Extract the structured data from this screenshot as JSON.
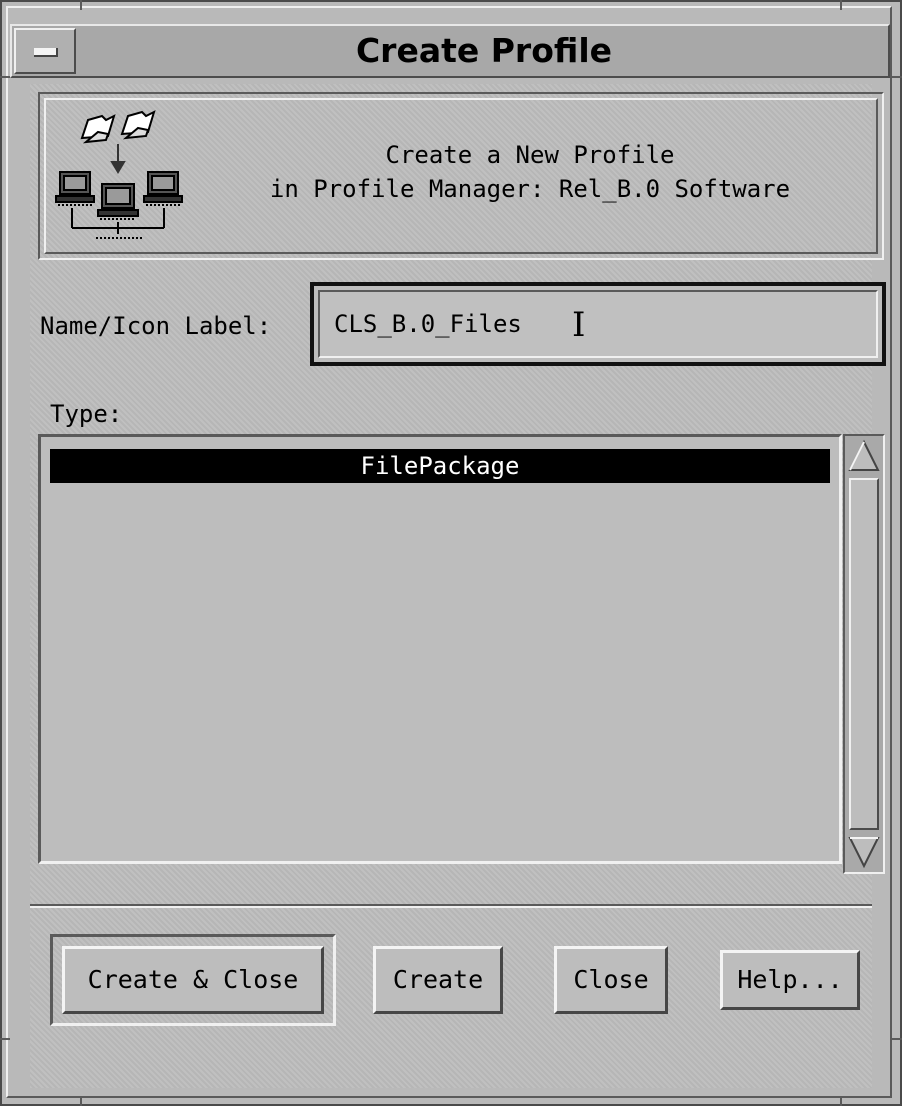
{
  "window": {
    "title": "Create Profile",
    "menu_button": "window-menu"
  },
  "header": {
    "line1": "Create a New Profile",
    "line2": "in Profile Manager: Rel_B.0 Software",
    "icon": "profile-network-icon"
  },
  "name_field": {
    "label": "Name/Icon Label:",
    "value": "CLS_B.0_Files"
  },
  "type_list": {
    "label": "Type:",
    "items": [
      "FilePackage"
    ],
    "selected": "FilePackage"
  },
  "buttons": {
    "create_close": "Create & Close",
    "create": "Create",
    "close": "Close",
    "help": "Help..."
  },
  "colors": {
    "background": "#bdbdbd",
    "selection": "#000000",
    "selection_text": "#ffffff"
  }
}
